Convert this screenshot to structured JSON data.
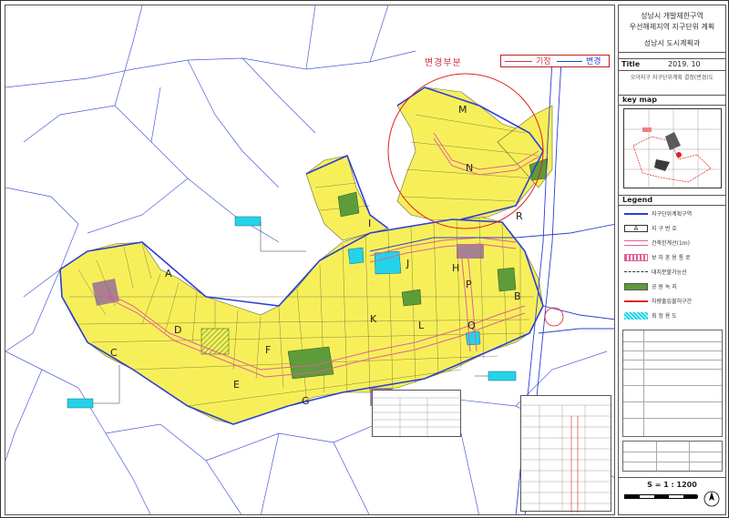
{
  "title_block": {
    "line1": "성남시 개발제한구역",
    "line2": "우선해제지역 지구단위 계획",
    "line3": "성남시 도시계획과"
  },
  "title_row": {
    "label": "Title",
    "date": "2019. 10"
  },
  "sub_title": "오야지구 지구단위계획 결정(변경)도",
  "keymap": {
    "heading": "key map"
  },
  "legend": {
    "heading": "Legend",
    "items": [
      {
        "label": "지구단위계획구역",
        "swatch": "line-blue"
      },
      {
        "label": "지 구 번 호",
        "swatch": "box-a"
      },
      {
        "label": "건축한계선(1m)",
        "swatch": "line-pink"
      },
      {
        "label": "보 차 혼 용 통 로",
        "swatch": "hatch-red"
      },
      {
        "label": "대지분할가능선",
        "swatch": "dash"
      },
      {
        "label": "공 원 녹 지",
        "swatch": "green"
      },
      {
        "label": "차량출입불허구간",
        "swatch": "line-red"
      },
      {
        "label": "최 정 용 도",
        "swatch": "cyan"
      }
    ]
  },
  "change_legend": {
    "changed": "변경부분",
    "old": "기정",
    "new": "변경"
  },
  "scale": {
    "text": "S = 1 : 1200"
  },
  "zone_labels": [
    "M",
    "N",
    "I",
    "J",
    "H",
    "B",
    "A",
    "C",
    "D",
    "E",
    "F",
    "G",
    "K",
    "L",
    "P",
    "Q",
    "R"
  ],
  "colors": {
    "yellow": "#f7ef5a",
    "green": "#5d9b3b",
    "cyan": "#23d3e8",
    "blue": "#2b3fd6",
    "pink": "#e0609a",
    "red": "#e02020",
    "purple": "#8a5fa0"
  }
}
